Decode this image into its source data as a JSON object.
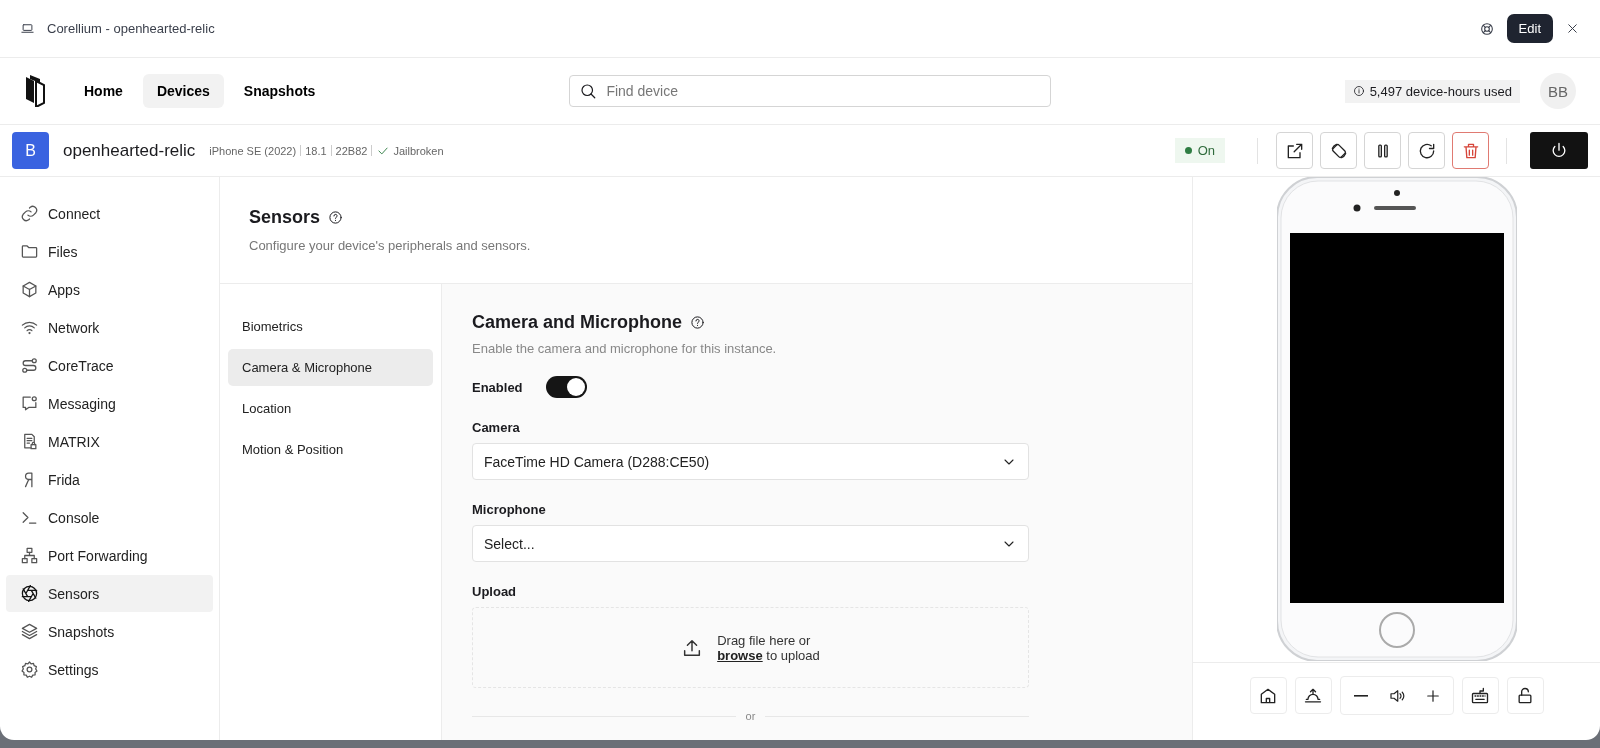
{
  "window": {
    "title": "Corellium - openhearted-relic",
    "edit_button": "Edit"
  },
  "nav": {
    "tabs": [
      {
        "label": "Home",
        "selected": false
      },
      {
        "label": "Devices",
        "selected": true
      },
      {
        "label": "Snapshots",
        "selected": false
      }
    ],
    "search": {
      "placeholder": "Find device"
    },
    "usage": "5,497 device-hours used",
    "avatar": "BB"
  },
  "device": {
    "avatar": "B",
    "name": "openhearted-relic",
    "model": "iPhone SE (2022)",
    "version": "18.1",
    "build": "22B82",
    "jailbroken": "Jailbroken",
    "status": "On"
  },
  "sidebar": {
    "items": [
      {
        "label": "Connect",
        "selected": false
      },
      {
        "label": "Files",
        "selected": false
      },
      {
        "label": "Apps",
        "selected": false
      },
      {
        "label": "Network",
        "selected": false
      },
      {
        "label": "CoreTrace",
        "selected": false
      },
      {
        "label": "Messaging",
        "selected": false
      },
      {
        "label": "MATRIX",
        "selected": false
      },
      {
        "label": "Frida",
        "selected": false
      },
      {
        "label": "Console",
        "selected": false
      },
      {
        "label": "Port Forwarding",
        "selected": false
      },
      {
        "label": "Sensors",
        "selected": true
      },
      {
        "label": "Snapshots",
        "selected": false
      },
      {
        "label": "Settings",
        "selected": false
      }
    ]
  },
  "page": {
    "title": "Sensors",
    "description": "Configure your device's peripherals and sensors."
  },
  "subnav": {
    "items": [
      {
        "label": "Biometrics",
        "selected": false
      },
      {
        "label": "Camera & Microphone",
        "selected": true
      },
      {
        "label": "Location",
        "selected": false
      },
      {
        "label": "Motion & Position",
        "selected": false
      }
    ]
  },
  "form": {
    "title": "Camera and Microphone",
    "description": "Enable the camera and microphone for this instance.",
    "enabled": {
      "label": "Enabled",
      "on": true
    },
    "camera": {
      "label": "Camera",
      "value": "FaceTime HD Camera (D288:CE50)"
    },
    "microphone": {
      "label": "Microphone",
      "placeholder": "Select..."
    },
    "upload": {
      "label": "Upload",
      "text": "Drag file here or",
      "link": "browse",
      "rest": "to upload"
    },
    "divider_text": "or"
  }
}
